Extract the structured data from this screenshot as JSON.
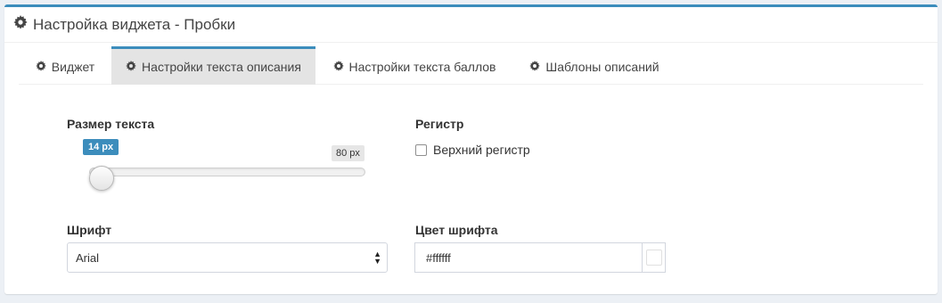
{
  "header": {
    "title": "Настройка виджета - Пробки",
    "icon": "gear-icon"
  },
  "tabs": [
    {
      "label": "Виджет",
      "icon": "gear-icon",
      "active": false
    },
    {
      "label": "Настройки текста описания",
      "icon": "gear-icon",
      "active": true
    },
    {
      "label": "Настройки текста баллов",
      "icon": "gear-icon",
      "active": false
    },
    {
      "label": "Шаблоны описаний",
      "icon": "gear-icon",
      "active": false
    }
  ],
  "text_size": {
    "label": "Размер текста",
    "current": "14 px",
    "max": "80 px",
    "value": 14,
    "range": [
      14,
      80
    ]
  },
  "register": {
    "label": "Регистр",
    "checkbox_label": "Верхний регистр",
    "checked": false
  },
  "font": {
    "label": "Шрифт",
    "selected": "Arial"
  },
  "font_color": {
    "label": "Цвет шрифта",
    "value": "#ffffff"
  },
  "colors": {
    "accent": "#3c8dbc",
    "active_tab_bg": "#e4e4e4"
  }
}
